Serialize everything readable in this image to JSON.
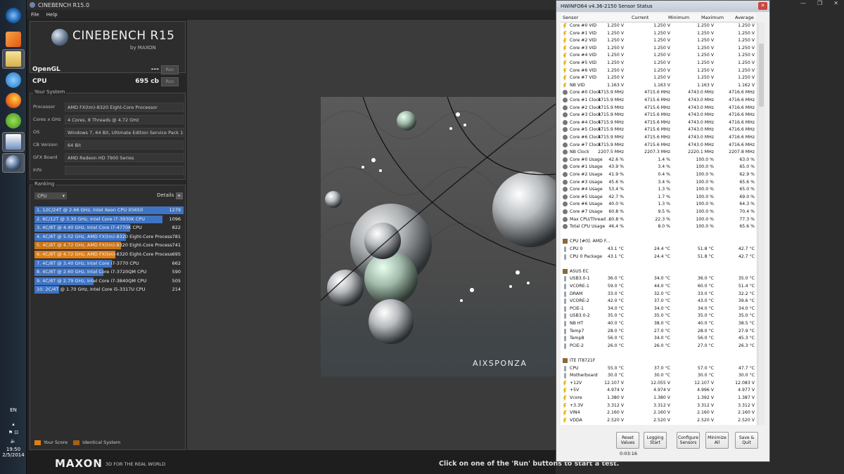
{
  "taskbar": {
    "clock_time": "19:50",
    "clock_date": "2/5/2014",
    "language": "EN"
  },
  "cinebench": {
    "window_title": "CINEBENCH R15.0",
    "menu": [
      "File",
      "Help"
    ],
    "logo_text": "CINEBENCH R15",
    "logo_sub": "by MAXON",
    "opengl_label": "OpenGL",
    "opengl_value": "---",
    "cpu_label": "CPU",
    "cpu_value": "695 cb",
    "run_label": "Run",
    "your_system_title": "Your System",
    "system": [
      {
        "label": "Processor",
        "value": "AMD FX(tm)-8320 Eight-Core Processor"
      },
      {
        "label": "Cores x GHz",
        "value": "4 Cores, 8 Threads @ 4.72 GHz"
      },
      {
        "label": "OS",
        "value": "Windows 7, 64 Bit, Ultimate Edition Service Pack 1 (b"
      },
      {
        "label": "CB Version",
        "value": "64 Bit"
      },
      {
        "label": "GFX Board",
        "value": "AMD Radeon HD 7900 Series"
      },
      {
        "label": "Info",
        "value": ""
      }
    ],
    "ranking_title": "Ranking",
    "ranking_dropdown": "CPU",
    "details_label": "Details",
    "ranking": [
      {
        "label": "1. 12C/24T @ 2.66 GHz, Intel Xeon CPU X5650",
        "score": "1279",
        "fraction": 1.0,
        "color": "#3f74c5"
      },
      {
        "label": "2. 6C/12T @ 3.30 GHz,  Intel Core i7-3930K CPU",
        "score": "1096",
        "fraction": 0.857,
        "color": "#3f74c5"
      },
      {
        "label": "3. 4C/8T @ 4.40 GHz, Intel Core i7-4770K CPU",
        "score": "822",
        "fraction": 0.643,
        "color": "#3f74c5"
      },
      {
        "label": "4. 4C/8T @ 5.02 GHz, AMD FX(tm)-8320 Eight-Core Process",
        "score": "781",
        "fraction": 0.611,
        "color": "#3f74c5"
      },
      {
        "label": "5. 4C/8T @ 4.72 GHz, AMD FX(tm)-8320 Eight-Core Process",
        "score": "741",
        "fraction": 0.579,
        "color": "#c97417"
      },
      {
        "label": "6. 4C/8T @ 4.72 GHz, AMD FX(tm)-8320 Eight-Core Process",
        "score": "695",
        "fraction": 0.543,
        "color": "#e07f16"
      },
      {
        "label": "7. 4C/8T @ 3.40 GHz,  Intel Core i7-3770 CPU",
        "score": "662",
        "fraction": 0.518,
        "color": "#3f74c5"
      },
      {
        "label": "8. 4C/8T @ 2.60 GHz, Intel Core i7-3720QM CPU",
        "score": "590",
        "fraction": 0.461,
        "color": "#3f74c5"
      },
      {
        "label": "9. 4C/8T @ 2.79 GHz,  Intel Core i7-3840QM CPU",
        "score": "505",
        "fraction": 0.395,
        "color": "#3f74c5"
      },
      {
        "label": "10. 2C/4T @ 1.70 GHz,  Intel Core i5-3317U CPU",
        "score": "214",
        "fraction": 0.167,
        "color": "#3f74c5"
      }
    ],
    "legend_your_score": "Your Score",
    "legend_identical": "Identical System",
    "colors": {
      "your_score": "#e07f16",
      "identical": "#a95f17",
      "rank_bar": "#3f74c5"
    },
    "maxon_logo": "MAXON",
    "maxon_tagline": "3D FOR THE REAL WORLD",
    "status_message": "Click on one of the 'Run' buttons to start a test.",
    "render_watermark": "AIXSPONZA"
  },
  "hwinfo": {
    "window_title": "HWiNFO64 v4.36-2150 Sensor Status",
    "columns": [
      "Sensor",
      "Current",
      "Minimum",
      "Maximum",
      "Average"
    ],
    "rows": [
      {
        "type": "volt",
        "name": "Core #0 VID",
        "cur": "1.250 V",
        "min": "1.250 V",
        "max": "1.250 V",
        "avg": "1.250 V"
      },
      {
        "type": "volt",
        "name": "Core #1 VID",
        "cur": "1.250 V",
        "min": "1.250 V",
        "max": "1.250 V",
        "avg": "1.250 V"
      },
      {
        "type": "volt",
        "name": "Core #2 VID",
        "cur": "1.250 V",
        "min": "1.250 V",
        "max": "1.250 V",
        "avg": "1.250 V"
      },
      {
        "type": "volt",
        "name": "Core #3 VID",
        "cur": "1.250 V",
        "min": "1.250 V",
        "max": "1.250 V",
        "avg": "1.250 V"
      },
      {
        "type": "volt",
        "name": "Core #4 VID",
        "cur": "1.250 V",
        "min": "1.250 V",
        "max": "1.250 V",
        "avg": "1.250 V"
      },
      {
        "type": "volt",
        "name": "Core #5 VID",
        "cur": "1.250 V",
        "min": "1.250 V",
        "max": "1.250 V",
        "avg": "1.250 V"
      },
      {
        "type": "volt",
        "name": "Core #6 VID",
        "cur": "1.250 V",
        "min": "1.250 V",
        "max": "1.250 V",
        "avg": "1.250 V"
      },
      {
        "type": "volt",
        "name": "Core #7 VID",
        "cur": "1.250 V",
        "min": "1.250 V",
        "max": "1.250 V",
        "avg": "1.250 V"
      },
      {
        "type": "volt",
        "name": "NB VID",
        "cur": "1.163 V",
        "min": "1.163 V",
        "max": "1.163 V",
        "avg": "1.162 V"
      },
      {
        "type": "clock",
        "name": "Core #0 Clock",
        "cur": "4715.9 MHz",
        "min": "4715.6 MHz",
        "max": "4743.0 MHz",
        "avg": "4716.6 MHz"
      },
      {
        "type": "clock",
        "name": "Core #1 Clock",
        "cur": "4715.9 MHz",
        "min": "4715.6 MHz",
        "max": "4743.0 MHz",
        "avg": "4716.6 MHz"
      },
      {
        "type": "clock",
        "name": "Core #2 Clock",
        "cur": "4715.9 MHz",
        "min": "4715.6 MHz",
        "max": "4743.0 MHz",
        "avg": "4716.6 MHz"
      },
      {
        "type": "clock",
        "name": "Core #3 Clock",
        "cur": "4715.9 MHz",
        "min": "4715.6 MHz",
        "max": "4743.0 MHz",
        "avg": "4716.6 MHz"
      },
      {
        "type": "clock",
        "name": "Core #4 Clock",
        "cur": "4715.9 MHz",
        "min": "4715.6 MHz",
        "max": "4743.0 MHz",
        "avg": "4716.6 MHz"
      },
      {
        "type": "clock",
        "name": "Core #5 Clock",
        "cur": "4715.9 MHz",
        "min": "4715.6 MHz",
        "max": "4743.0 MHz",
        "avg": "4716.6 MHz"
      },
      {
        "type": "clock",
        "name": "Core #6 Clock",
        "cur": "4715.9 MHz",
        "min": "4715.6 MHz",
        "max": "4743.0 MHz",
        "avg": "4716.6 MHz"
      },
      {
        "type": "clock",
        "name": "Core #7 Clock",
        "cur": "4715.9 MHz",
        "min": "4715.6 MHz",
        "max": "4743.0 MHz",
        "avg": "4716.6 MHz"
      },
      {
        "type": "clock",
        "name": "NB Clock",
        "cur": "2207.5 MHz",
        "min": "2207.3 MHz",
        "max": "2220.1 MHz",
        "avg": "2207.8 MHz"
      },
      {
        "type": "clock",
        "name": "Core #0 Usage",
        "cur": "42.6 %",
        "min": "1.4 %",
        "max": "100.0 %",
        "avg": "63.0 %"
      },
      {
        "type": "clock",
        "name": "Core #1 Usage",
        "cur": "43.9 %",
        "min": "3.4 %",
        "max": "100.0 %",
        "avg": "65.0 %"
      },
      {
        "type": "clock",
        "name": "Core #2 Usage",
        "cur": "41.9 %",
        "min": "0.4 %",
        "max": "100.0 %",
        "avg": "62.9 %"
      },
      {
        "type": "clock",
        "name": "Core #3 Usage",
        "cur": "45.6 %",
        "min": "3.4 %",
        "max": "100.0 %",
        "avg": "65.6 %"
      },
      {
        "type": "clock",
        "name": "Core #4 Usage",
        "cur": "53.4 %",
        "min": "1.3 %",
        "max": "100.0 %",
        "avg": "65.0 %"
      },
      {
        "type": "clock",
        "name": "Core #5 Usage",
        "cur": "42.7 %",
        "min": "1.7 %",
        "max": "100.0 %",
        "avg": "69.0 %"
      },
      {
        "type": "clock",
        "name": "Core #6 Usage",
        "cur": "40.0 %",
        "min": "1.3 %",
        "max": "100.0 %",
        "avg": "64.3 %"
      },
      {
        "type": "clock",
        "name": "Core #7 Usage",
        "cur": "60.8 %",
        "min": "9.5 %",
        "max": "100.0 %",
        "avg": "70.4 %"
      },
      {
        "type": "clock",
        "name": "Max CPU/Thread ...",
        "cur": "60.8 %",
        "min": "22.3 %",
        "max": "100.0 %",
        "avg": "77.3 %"
      },
      {
        "type": "clock",
        "name": "Total CPU Usage",
        "cur": "46.4 %",
        "min": "8.0 %",
        "max": "100.0 %",
        "avg": "65.6 %"
      },
      {
        "type": "blank",
        "name": "",
        "cur": "",
        "min": "",
        "max": "",
        "avg": ""
      },
      {
        "type": "chip",
        "name": "CPU [#0]: AMD F...",
        "cur": "",
        "min": "",
        "max": "",
        "avg": ""
      },
      {
        "type": "temp",
        "name": "CPU 0",
        "cur": "43.1 °C",
        "min": "24.4 °C",
        "max": "51.8 °C",
        "avg": "42.7 °C"
      },
      {
        "type": "temp",
        "name": "CPU 0 Package",
        "cur": "43.1 °C",
        "min": "24.4 °C",
        "max": "51.8 °C",
        "avg": "42.7 °C"
      },
      {
        "type": "blank",
        "name": "",
        "cur": "",
        "min": "",
        "max": "",
        "avg": ""
      },
      {
        "type": "chip",
        "name": "ASUS EC",
        "cur": "",
        "min": "",
        "max": "",
        "avg": ""
      },
      {
        "type": "temp",
        "name": "USB3.0-1",
        "cur": "36.0 °C",
        "min": "34.0 °C",
        "max": "36.0 °C",
        "avg": "35.0 °C"
      },
      {
        "type": "temp",
        "name": "VCORE-1",
        "cur": "59.0 °C",
        "min": "44.0 °C",
        "max": "60.0 °C",
        "avg": "51.4 °C"
      },
      {
        "type": "temp",
        "name": "DRAM",
        "cur": "33.0 °C",
        "min": "32.0 °C",
        "max": "33.0 °C",
        "avg": "32.2 °C"
      },
      {
        "type": "temp",
        "name": "VCORE-2",
        "cur": "42.0 °C",
        "min": "37.0 °C",
        "max": "43.0 °C",
        "avg": "39.6 °C"
      },
      {
        "type": "temp",
        "name": "PCIE-1",
        "cur": "34.0 °C",
        "min": "34.0 °C",
        "max": "34.0 °C",
        "avg": "34.0 °C"
      },
      {
        "type": "temp",
        "name": "USB3.0-2",
        "cur": "35.0 °C",
        "min": "35.0 °C",
        "max": "35.0 °C",
        "avg": "35.0 °C"
      },
      {
        "type": "temp",
        "name": "NB HT",
        "cur": "40.0 °C",
        "min": "38.0 °C",
        "max": "40.0 °C",
        "avg": "38.5 °C"
      },
      {
        "type": "temp",
        "name": "Temp7",
        "cur": "28.0 °C",
        "min": "27.0 °C",
        "max": "28.0 °C",
        "avg": "27.9 °C"
      },
      {
        "type": "temp",
        "name": "Temp8",
        "cur": "56.0 °C",
        "min": "34.0 °C",
        "max": "56.0 °C",
        "avg": "45.3 °C"
      },
      {
        "type": "temp",
        "name": "PCIE-2",
        "cur": "26.0 °C",
        "min": "26.0 °C",
        "max": "27.0 °C",
        "avg": "26.3 °C"
      },
      {
        "type": "blank",
        "name": "",
        "cur": "",
        "min": "",
        "max": "",
        "avg": ""
      },
      {
        "type": "chip",
        "name": "ITE IT8721F",
        "cur": "",
        "min": "",
        "max": "",
        "avg": ""
      },
      {
        "type": "temp",
        "name": "CPU",
        "cur": "55.0 °C",
        "min": "37.0 °C",
        "max": "57.0 °C",
        "avg": "47.7 °C"
      },
      {
        "type": "temp",
        "name": "Motherboard",
        "cur": "30.0 °C",
        "min": "30.0 °C",
        "max": "30.0 °C",
        "avg": "30.0 °C"
      },
      {
        "type": "volt",
        "name": "+12V",
        "cur": "12.107 V",
        "min": "12.055 V",
        "max": "12.107 V",
        "avg": "12.083 V"
      },
      {
        "type": "volt",
        "name": "+5V",
        "cur": "4.974 V",
        "min": "4.974 V",
        "max": "4.996 V",
        "avg": "4.977 V"
      },
      {
        "type": "volt",
        "name": "Vcore",
        "cur": "1.380 V",
        "min": "1.380 V",
        "max": "1.392 V",
        "avg": "1.387 V"
      },
      {
        "type": "volt",
        "name": "+3.3V",
        "cur": "3.312 V",
        "min": "3.312 V",
        "max": "3.312 V",
        "avg": "3.312 V"
      },
      {
        "type": "volt",
        "name": "VIN4",
        "cur": "2.160 V",
        "min": "2.160 V",
        "max": "2.160 V",
        "avg": "2.160 V"
      },
      {
        "type": "volt",
        "name": "VDDA",
        "cur": "2.520 V",
        "min": "2.520 V",
        "max": "2.520 V",
        "avg": "2.520 V"
      }
    ],
    "buttons": [
      "Reset Values",
      "Logging Start",
      "Configure Sensors",
      "Minimize All",
      "Save & Quit"
    ],
    "timer": "0:03:16"
  }
}
